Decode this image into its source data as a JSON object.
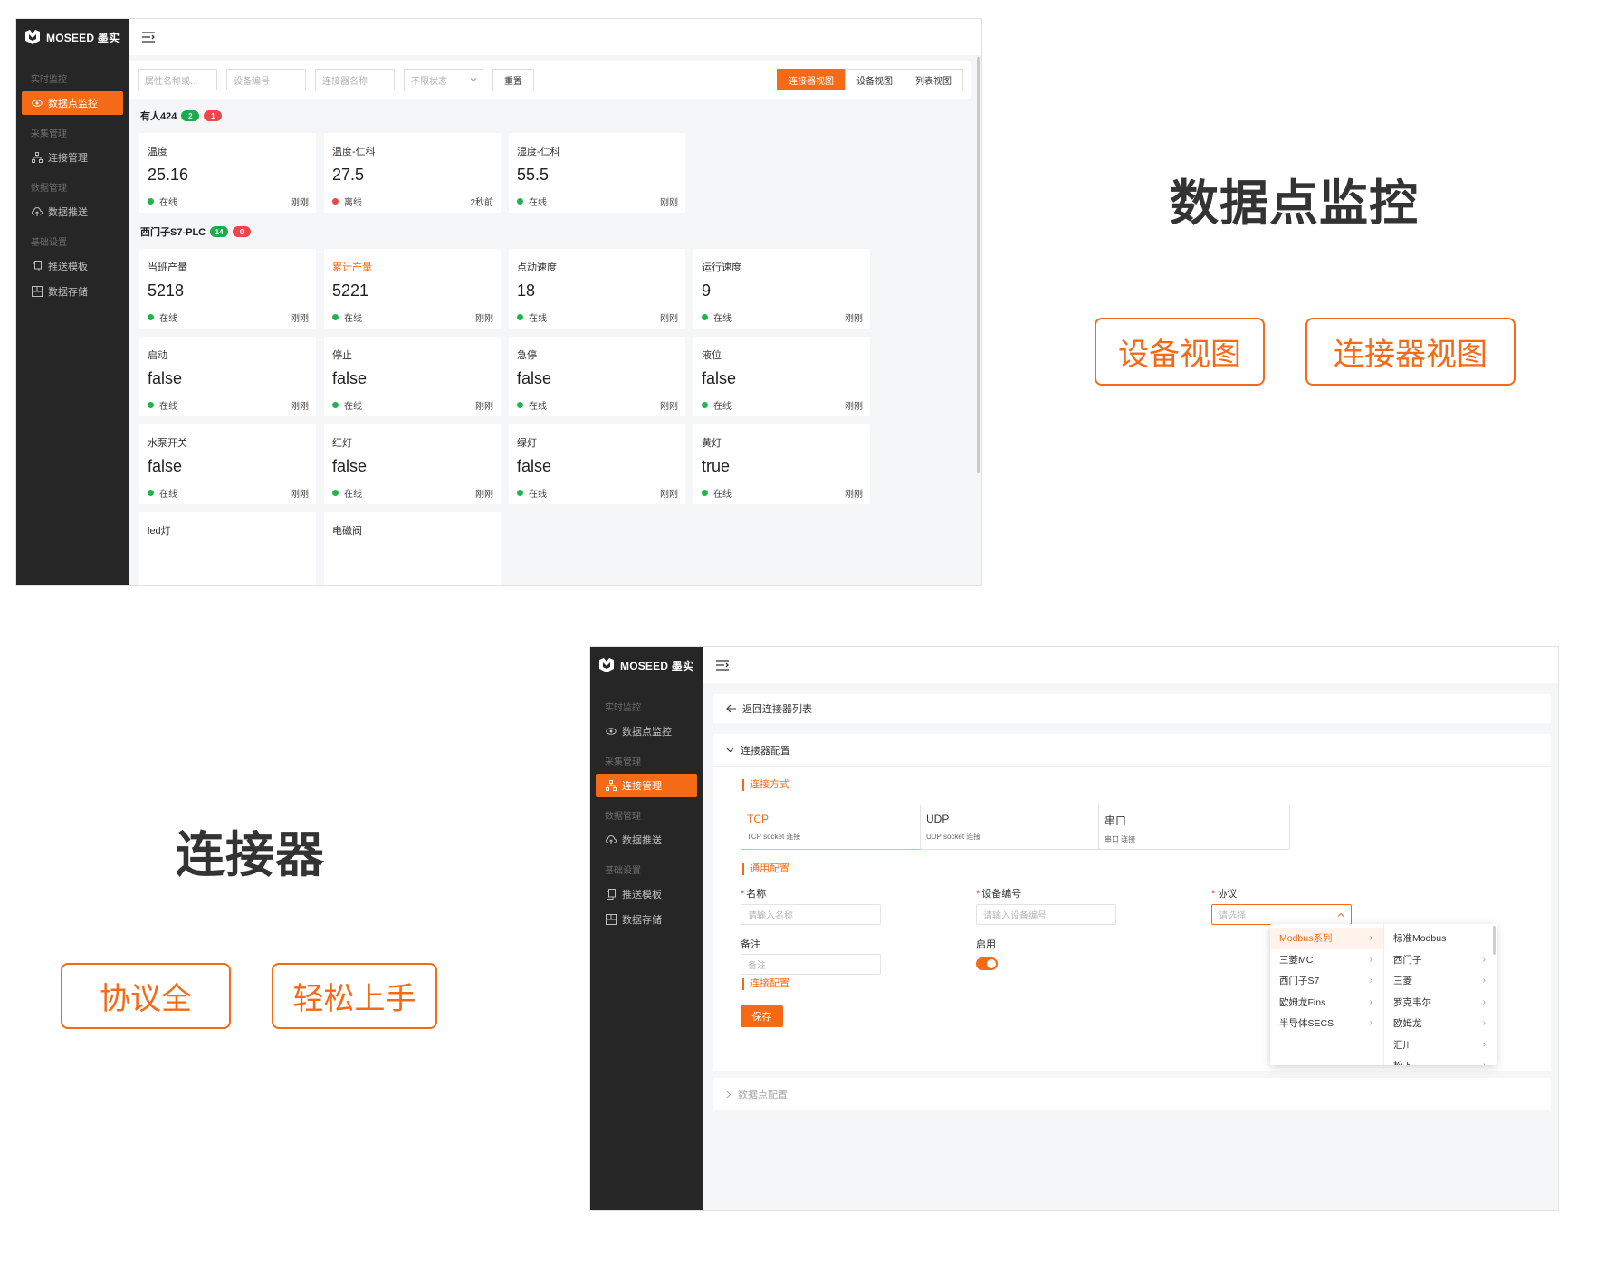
{
  "brand": {
    "name": "MOSEED 墨实"
  },
  "sidebar": {
    "groups": [
      {
        "label": "实时监控",
        "items": [
          {
            "label": "数据点监控",
            "icon": "eye-icon"
          }
        ]
      },
      {
        "label": "采集管理",
        "items": [
          {
            "label": "连接管理",
            "icon": "network-icon"
          }
        ]
      },
      {
        "label": "数据管理",
        "items": [
          {
            "label": "数据推送",
            "icon": "cloud-upload-icon"
          }
        ]
      },
      {
        "label": "基础设置",
        "items": [
          {
            "label": "推送模板",
            "icon": "copy-icon"
          },
          {
            "label": "数据存储",
            "icon": "storage-icon"
          }
        ]
      }
    ]
  },
  "monitor": {
    "filters": {
      "attr_placeholder": "属性名称或...",
      "device_placeholder": "设备编号",
      "connector_placeholder": "连接器名称",
      "status_placeholder": "不限状态",
      "reset_label": "重置"
    },
    "views": [
      "连接器视图",
      "设备视图",
      "列表视图"
    ],
    "groups": [
      {
        "title": "有人424",
        "online_count": "2",
        "offline_count": "1",
        "rows": [
          [
            {
              "name": "温度",
              "value": "25.16",
              "status": "在线",
              "time": "刚刚"
            },
            {
              "name": "温度-仁科",
              "value": "27.5",
              "status": "离线",
              "time": "2秒前"
            },
            {
              "name": "湿度-仁科",
              "value": "55.5",
              "status": "在线",
              "time": "刚刚"
            }
          ]
        ]
      },
      {
        "title": "西门子S7-PLC",
        "online_count": "14",
        "offline_count": "0",
        "rows": [
          [
            {
              "name": "当班产量",
              "value": "5218",
              "status": "在线",
              "time": "刚刚"
            },
            {
              "name": "累计产量",
              "value": "5221",
              "status": "在线",
              "time": "刚刚"
            },
            {
              "name": "点动速度",
              "value": "18",
              "status": "在线",
              "time": "刚刚"
            },
            {
              "name": "运行速度",
              "value": "9",
              "status": "在线",
              "time": "刚刚"
            }
          ],
          [
            {
              "name": "启动",
              "value": "false",
              "status": "在线",
              "time": "刚刚"
            },
            {
              "name": "停止",
              "value": "false",
              "status": "在线",
              "time": "刚刚"
            },
            {
              "name": "急停",
              "value": "false",
              "status": "在线",
              "time": "刚刚"
            },
            {
              "name": "液位",
              "value": "false",
              "status": "在线",
              "time": "刚刚"
            }
          ],
          [
            {
              "name": "水泵开关",
              "value": "false",
              "status": "在线",
              "time": "刚刚"
            },
            {
              "name": "红灯",
              "value": "false",
              "status": "在线",
              "time": "刚刚"
            },
            {
              "name": "绿灯",
              "value": "false",
              "status": "在线",
              "time": "刚刚"
            },
            {
              "name": "黄灯",
              "value": "true",
              "status": "在线",
              "time": "刚刚"
            }
          ],
          [
            {
              "name": "led灯"
            },
            {
              "name": "电磁阀"
            }
          ]
        ]
      }
    ]
  },
  "callouts": {
    "headline1": "数据点监控",
    "tag_device_view": "设备视图",
    "tag_connector_view": "连接器视图",
    "headline2": "连接器",
    "tag_protocols": "协议全",
    "tag_easy": "轻松上手"
  },
  "connector": {
    "back_label": "返回连接器列表",
    "panel_title": "连接器配置",
    "section_method": "连接方式",
    "methods": [
      {
        "title": "TCP",
        "sub": "TCP socket 连接"
      },
      {
        "title": "UDP",
        "sub": "UDP socket 连接"
      },
      {
        "title": "串口",
        "sub": "串口 连接"
      }
    ],
    "section_general": "通用配置",
    "name_label": "名称",
    "name_placeholder": "请输入名称",
    "device_label": "设备编号",
    "device_placeholder": "请输入设备编号",
    "protocol_label": "协议",
    "protocol_placeholder": "请选择",
    "remark_label": "备注",
    "remark_placeholder": "备注",
    "enable_label": "启用",
    "section_connection": "连接配置",
    "save_label": "保存",
    "datapoint_panel": "数据点配置",
    "dropdown_left": [
      "Modbus系列",
      "三菱MC",
      "西门子S7",
      "欧姆龙Fins",
      "半导体SECS"
    ],
    "dropdown_right": [
      "标准Modbus",
      "西门子",
      "三菱",
      "罗克韦尔",
      "欧姆龙",
      "汇川",
      "松下"
    ]
  },
  "colors": {
    "accent": "#f56a16",
    "sidebar": "#262626",
    "online": "#1fb44e",
    "offline": "#e8474c"
  }
}
